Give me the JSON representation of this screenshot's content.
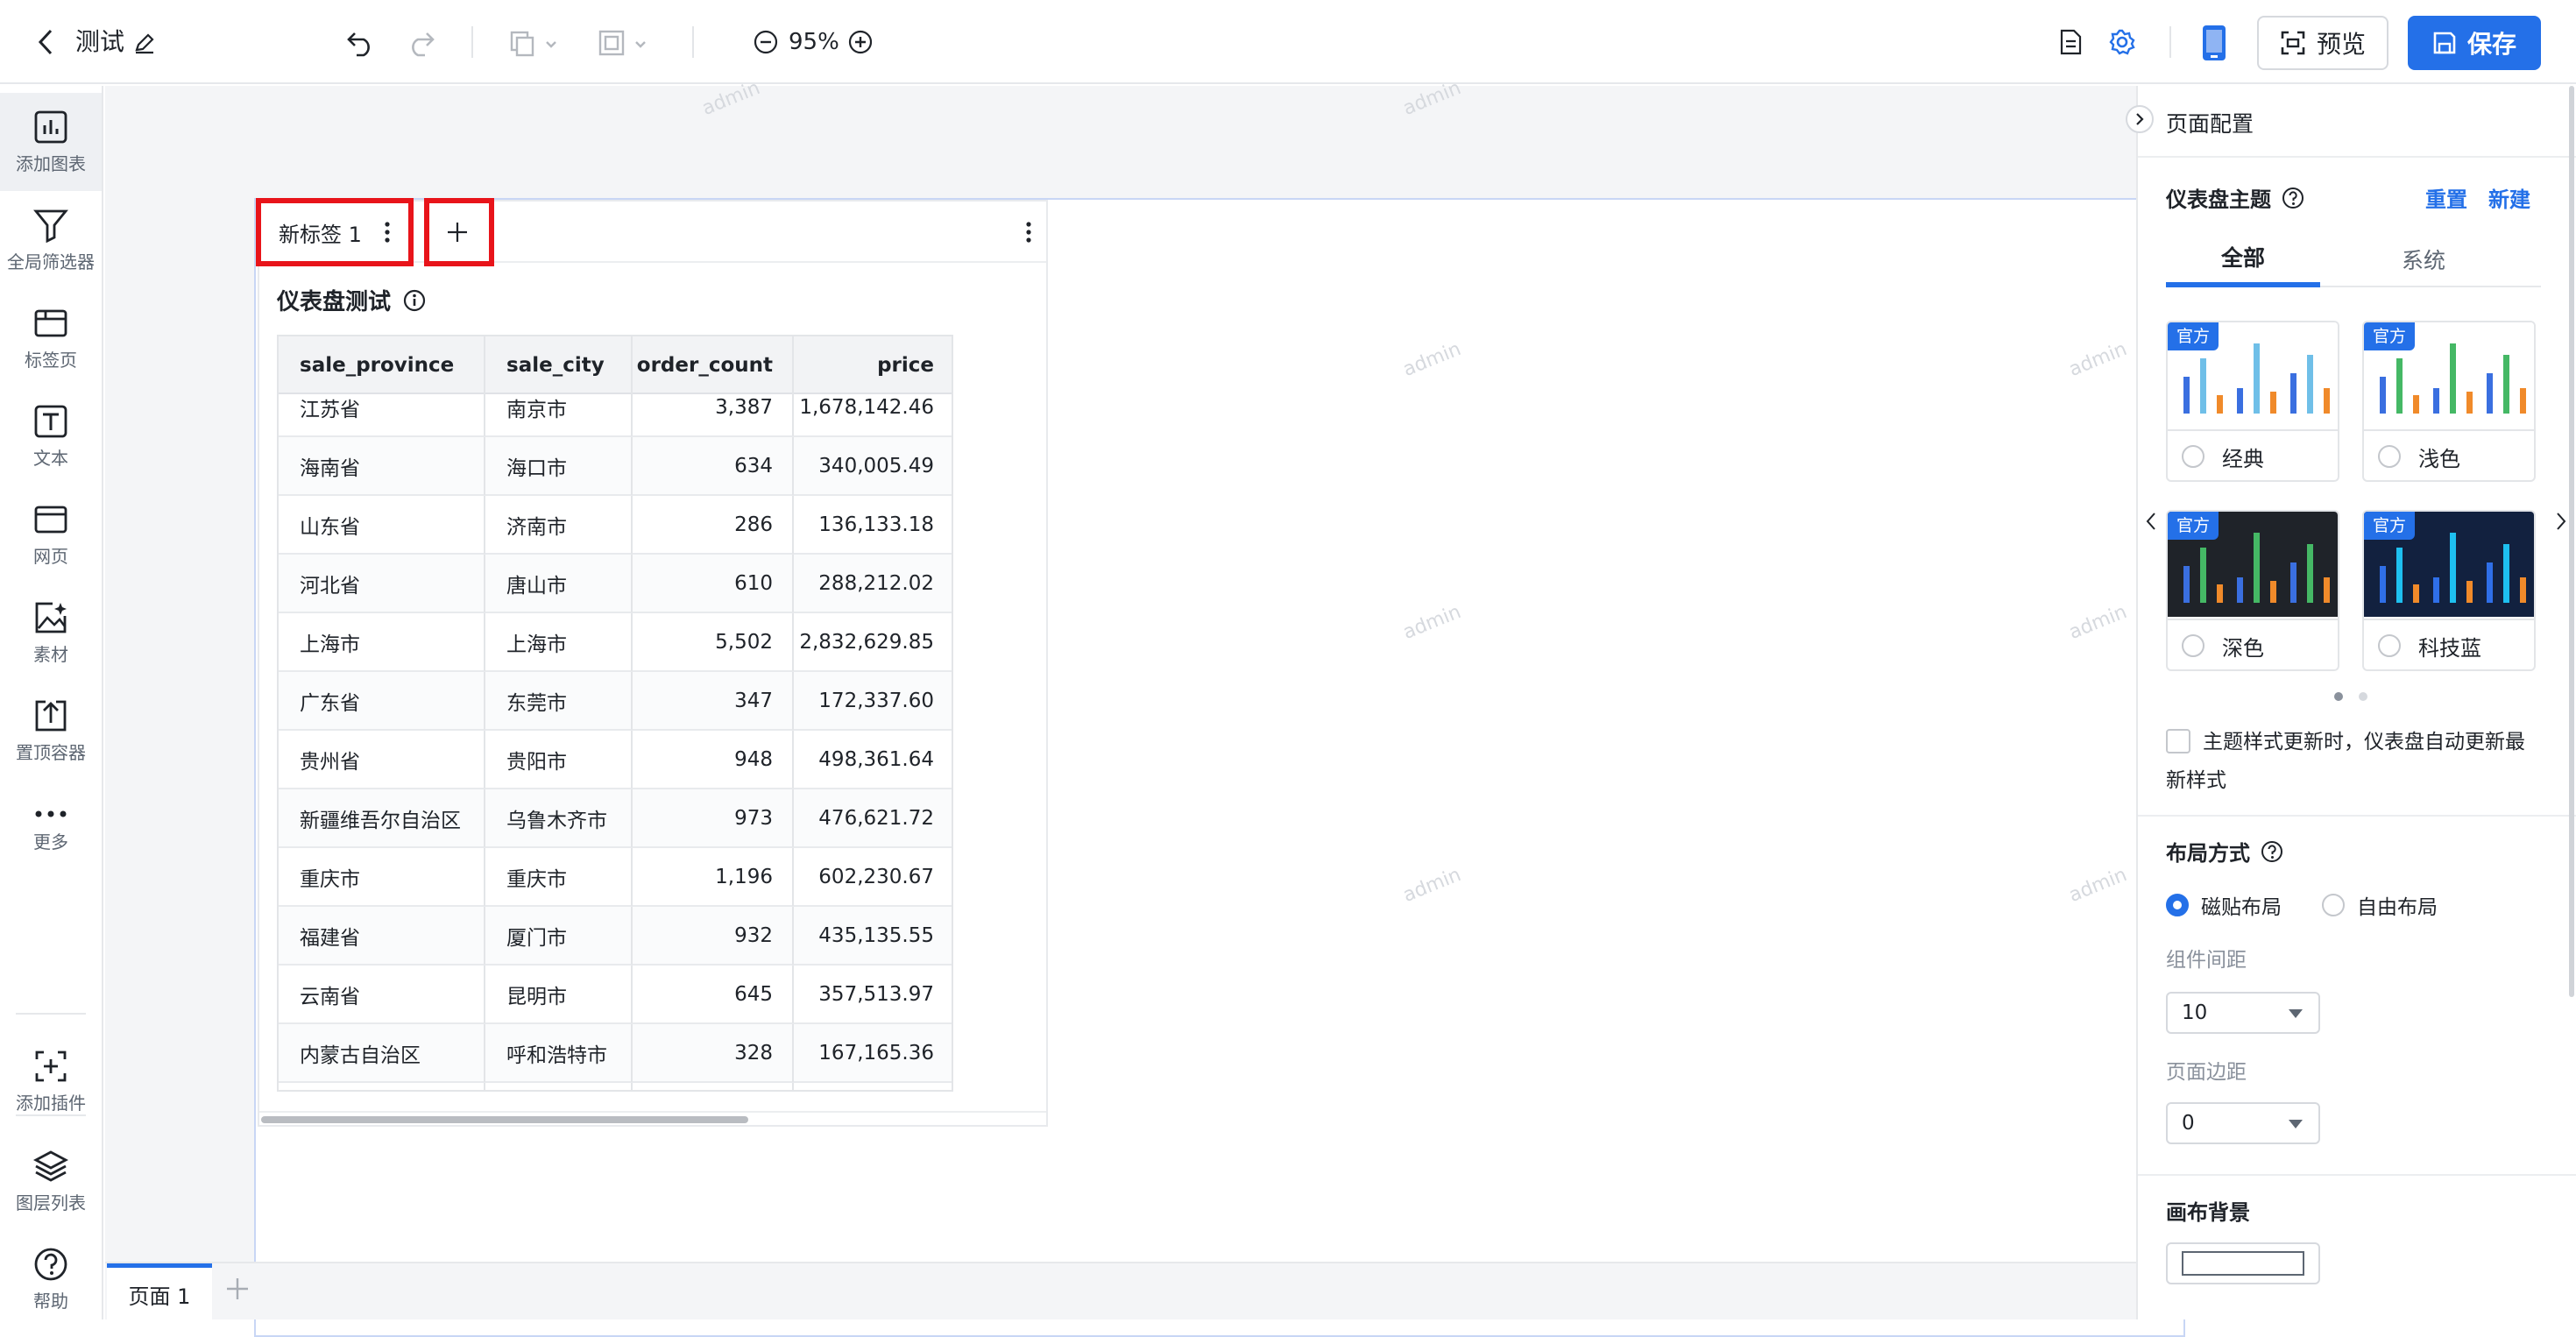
{
  "topbar": {
    "title": "测试",
    "zoom": "95%",
    "preview_label": "预览",
    "save_label": "保存",
    "accent_color": "#2470e8"
  },
  "sidebar": {
    "items": [
      {
        "label": "添加图表",
        "icon": "chart-icon"
      },
      {
        "label": "全局筛选器",
        "icon": "filter-icon"
      },
      {
        "label": "标签页",
        "icon": "tab-page-icon"
      },
      {
        "label": "文本",
        "icon": "text-icon"
      },
      {
        "label": "网页",
        "icon": "webpage-icon"
      },
      {
        "label": "素材",
        "icon": "material-icon"
      },
      {
        "label": "置顶容器",
        "icon": "pin-container-icon"
      },
      {
        "label": "更多",
        "icon": "more-icon"
      }
    ],
    "bottom_items": [
      {
        "label": "添加插件",
        "icon": "plugin-icon"
      },
      {
        "label": "图层列表",
        "icon": "layers-icon"
      },
      {
        "label": "帮助",
        "icon": "help-icon"
      }
    ]
  },
  "widget": {
    "tab_label": "新标签 1",
    "title": "仪表盘测试",
    "table": {
      "columns": [
        "sale_province",
        "sale_city",
        "order_count",
        "price"
      ],
      "rows": [
        [
          "江苏省",
          "南京市",
          "3,387",
          "1,678,142.46"
        ],
        [
          "海南省",
          "海口市",
          "634",
          "340,005.49"
        ],
        [
          "山东省",
          "济南市",
          "286",
          "136,133.18"
        ],
        [
          "河北省",
          "唐山市",
          "610",
          "288,212.02"
        ],
        [
          "上海市",
          "上海市",
          "5,502",
          "2,832,629.85"
        ],
        [
          "广东省",
          "东莞市",
          "347",
          "172,337.60"
        ],
        [
          "贵州省",
          "贵阳市",
          "948",
          "498,361.64"
        ],
        [
          "新疆维吾尔自治区",
          "乌鲁木齐市",
          "973",
          "476,621.72"
        ],
        [
          "重庆市",
          "重庆市",
          "1,196",
          "602,230.67"
        ],
        [
          "福建省",
          "厦门市",
          "932",
          "435,135.55"
        ],
        [
          "云南省",
          "昆明市",
          "645",
          "357,513.97"
        ],
        [
          "内蒙古自治区",
          "呼和浩特市",
          "328",
          "167,165.36"
        ]
      ]
    }
  },
  "watermark": "admin",
  "pages": {
    "current": "页面 1"
  },
  "right_panel": {
    "title": "页面配置",
    "theme_section": {
      "label": "仪表盘主题",
      "reset": "重置",
      "new": "新建",
      "tabs": [
        "全部",
        "系统"
      ],
      "badge": "官方",
      "themes": [
        {
          "name": "经典",
          "bg": "#ffffff",
          "colors": [
            "#3a6fe0",
            "#6fbfe8",
            "#f08a2a"
          ]
        },
        {
          "name": "浅色",
          "bg": "#ffffff",
          "colors": [
            "#3a6fe0",
            "#45b865",
            "#f08a2a"
          ]
        },
        {
          "name": "深色",
          "bg": "#1f2329",
          "colors": [
            "#3a6fe0",
            "#45b865",
            "#f08a2a"
          ]
        },
        {
          "name": "科技蓝",
          "bg": "#12213f",
          "colors": [
            "#2f6fe8",
            "#1ec0f0",
            "#f08a2a"
          ]
        }
      ],
      "auto_update_text_1": "主题样式更新时，仪表盘自动更新最",
      "auto_update_text_2": "新样式"
    },
    "layout_section": {
      "label": "布局方式",
      "options": [
        "磁贴布局",
        "自由布局"
      ],
      "selected": "磁贴布局",
      "gap_label": "组件间距",
      "gap_value": "10",
      "margin_label": "页面边距",
      "margin_value": "0"
    },
    "background_section": {
      "label": "画布背景"
    }
  }
}
